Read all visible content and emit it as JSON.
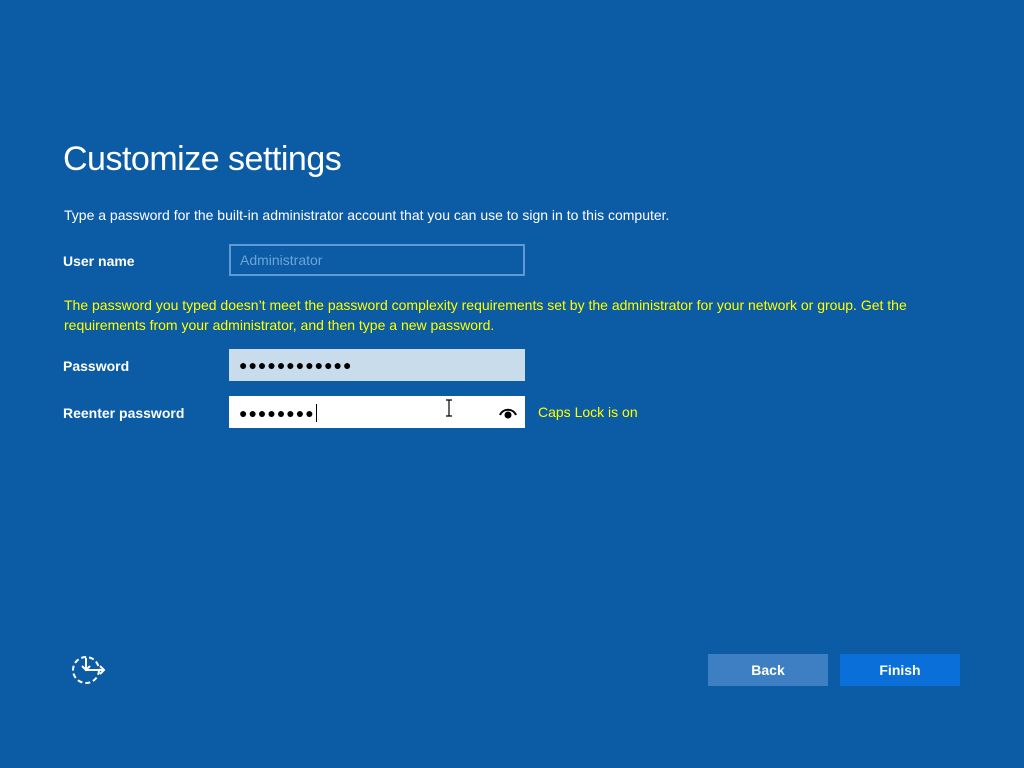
{
  "page": {
    "title": "Customize settings",
    "subtitle": "Type a password for the built-in administrator account that you can use to sign in to this computer."
  },
  "form": {
    "username_label": "User name",
    "username_placeholder": "Administrator",
    "error_message": "The password you typed doesn’t meet the password complexity requirements set by the administrator for your network or group. Get the requirements from your administrator, and then type a new password.",
    "password_label": "Password",
    "password_value": "●●●●●●●●●●●●",
    "reenter_label": "Reenter password",
    "reenter_value": "●●●●●●●●",
    "caps_lock_warning": "Caps Lock is on"
  },
  "buttons": {
    "back_label": "Back",
    "finish_label": "Finish"
  },
  "icons": {
    "ease_of_access": "ease-of-access-icon",
    "reveal_password": "eye-icon",
    "text_cursor": "ibeam-cursor-icon"
  },
  "colors": {
    "background": "#0b5ba5",
    "warning": "#ffff00",
    "finish_button": "#0a6fd8",
    "back_button": "#3d7fc2"
  }
}
